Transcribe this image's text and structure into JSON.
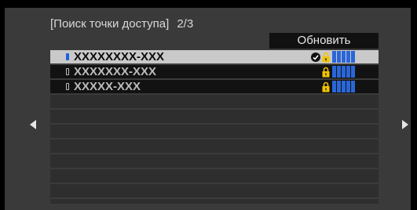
{
  "header": {
    "title": "[Поиск точки доступа]",
    "page_indicator": "2/3"
  },
  "refresh_button": {
    "label": "Обновить"
  },
  "access_points": [
    {
      "ssid": "XXXXXXXX-XXX",
      "selected": true,
      "connected": true,
      "secured": true,
      "signal_bars": 5
    },
    {
      "ssid": "XXXXXXX-XXX",
      "selected": false,
      "connected": false,
      "secured": true,
      "signal_bars": 5
    },
    {
      "ssid": "XXXXX-XXX",
      "selected": false,
      "connected": false,
      "secured": true,
      "signal_bars": 5
    }
  ],
  "empty_rows": 7,
  "navigation": {
    "prev_icon": "triangle-left-icon",
    "next_icon": "triangle-right-icon"
  },
  "colors": {
    "background": "#3a3a3a",
    "selected_row": "#c9c9c9",
    "signal_bar": "#2a66d8",
    "lock_icon": "#f2c400"
  }
}
